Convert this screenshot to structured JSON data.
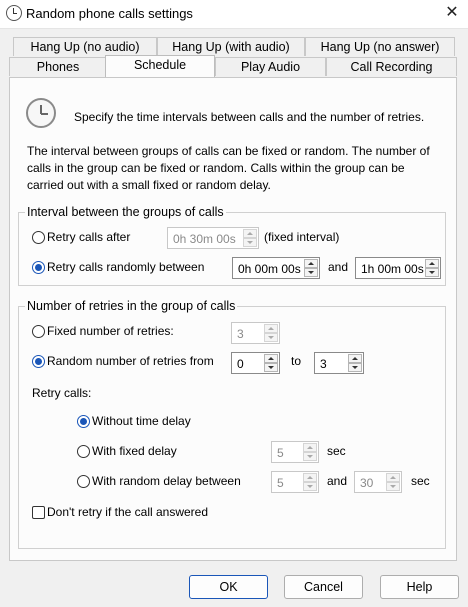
{
  "window": {
    "title": "Random phone calls settings",
    "close_glyph": "✕"
  },
  "tabs": {
    "row1": [
      "Hang Up (no audio)",
      "Hang Up (with audio)",
      "Hang Up (no answer)"
    ],
    "row2": [
      "Phones",
      "Schedule",
      "Play Audio",
      "Call Recording"
    ],
    "active": "Schedule"
  },
  "intro": {
    "heading": "Specify the time intervals between calls and the number of retries.",
    "paragraph": "The interval between groups of calls can be fixed or random. The number of calls in the group can be fixed or random. Calls within the group can be carried out with a small fixed or random delay."
  },
  "interval_group": {
    "legend": "Interval between the groups of calls",
    "fixed_label": "Retry calls after",
    "fixed_value": "0h 30m 00s",
    "fixed_note": "(fixed interval)",
    "random_label": "Retry calls randomly between",
    "random_from": "0h 00m 00s",
    "and_label": "and",
    "random_to": "1h 00m 00s",
    "selected": "random"
  },
  "retries_group": {
    "legend": "Number of retries in the group of calls",
    "fixed_label": "Fixed number of retries:",
    "fixed_value": "3",
    "random_label": "Random number of retries from",
    "random_from": "0",
    "to_label": "to",
    "random_to": "3",
    "selected": "random",
    "retry_calls_label": "Retry calls:",
    "without_delay_label": "Without time delay",
    "fixed_delay_label": "With fixed delay",
    "fixed_delay_value": "5",
    "sec_label": "sec",
    "random_delay_label": "With random delay between",
    "random_delay_from": "5",
    "random_delay_and": "and",
    "random_delay_to": "30",
    "delay_selected": "without",
    "dont_retry_label": "Don't retry if the call answered",
    "dont_retry_checked": false
  },
  "buttons": {
    "ok": "OK",
    "cancel": "Cancel",
    "help": "Help"
  },
  "colors": {
    "accent": "#1a56b8",
    "background": "#f0f0f0",
    "panel": "#fcfcfc"
  }
}
